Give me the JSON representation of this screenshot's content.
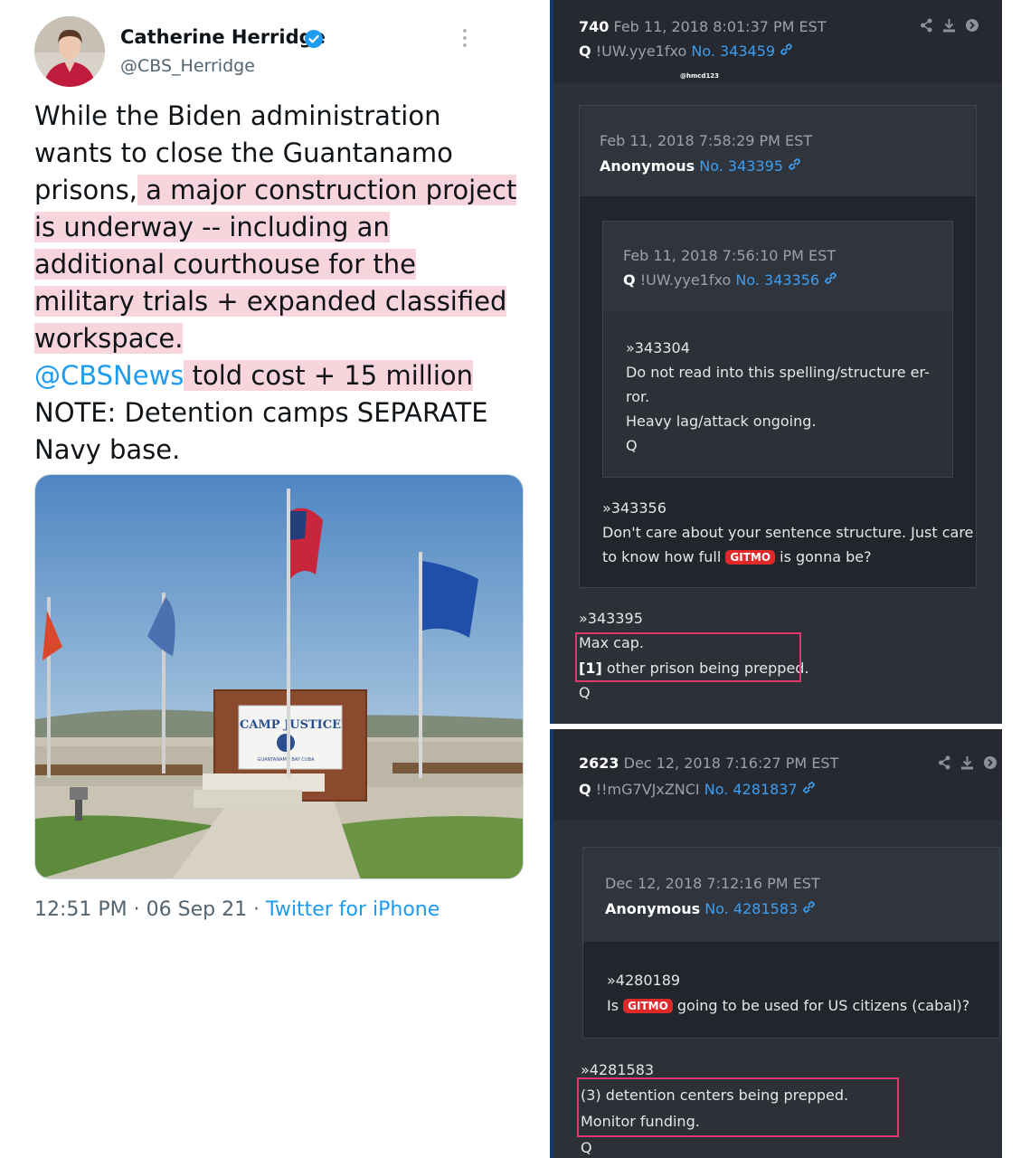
{
  "tweet": {
    "author_name": "Catherine Herridge",
    "author_handle": "@CBS_Herridge",
    "body_before_highlight": "While the Biden administration wants to close the Guantanamo prisons,",
    "body_highlight": " a major construction project is underway -- including an additional courthouse for the military trials + expanded classified workspace.",
    "mention": "@CBSNews",
    "body_highlight_2": " told cost + 15 million",
    "body_after": "NOTE: Detention camps SEPARATE Navy base.",
    "photo_sign_title": "CAMP JUSTICE",
    "photo_sign_subtitle": "GUANTANAMO BAY CUBA",
    "timestamp": "12:51 PM · 06 Sep 21 · ",
    "source": "Twitter for iPhone"
  },
  "post1": {
    "number": "740",
    "date": "Feb 11, 2018 8:01:37 PM EST",
    "author": "Q",
    "tripcode": "!UW.yye1fxo",
    "post_no": "No. 343459",
    "watermark": "@hmcd123",
    "quote1": {
      "date": "Feb 11, 2018 7:58:29 PM EST",
      "author": "Anonymous",
      "post_no": "No. 343395",
      "quote2": {
        "date": "Feb 11, 2018 7:56:10 PM EST",
        "author": "Q",
        "tripcode": "!UW.yye1fxo",
        "post_no": "No. 343356",
        "lines": [
          "»343304",
          "Do not read into this spelling/structure er-",
          "ror.",
          "Heavy lag/attack ongoing.",
          "Q"
        ]
      },
      "ref": "»343356",
      "line1": "Don't care about your sentence structure. Just care",
      "line2_pre": "to know how full ",
      "tag": "GITMO",
      "line2_post": " is gonna be?"
    },
    "ref": "»343395",
    "line1": "Max cap.",
    "line2_num": "[1]",
    "line2_rest": " other prison being prepped.",
    "sign": "Q"
  },
  "post2": {
    "number": "2623",
    "date": "Dec 12, 2018 7:16:27 PM EST",
    "author": "Q",
    "tripcode": "!!mG7VJxZNCI",
    "post_no": "No. 4281837",
    "quote1": {
      "date": "Dec 12, 2018 7:12:16 PM EST",
      "author": "Anonymous",
      "post_no": "No. 4281583",
      "ref": "»4280189",
      "line_pre": "Is ",
      "tag": "GITMO",
      "line_post": " going to be used for US citizens (cabal)?"
    },
    "ref": "»4281583",
    "line1": "(3) detention centers being prepped.",
    "line2": "Monitor funding.",
    "sign": "Q"
  },
  "colors": {
    "highlight": "#f8d4dc",
    "link": "#1d9bf0",
    "q_link": "#3d9df0",
    "gitmo_tag": "#e02a2a",
    "red_box": "#e4386a"
  }
}
